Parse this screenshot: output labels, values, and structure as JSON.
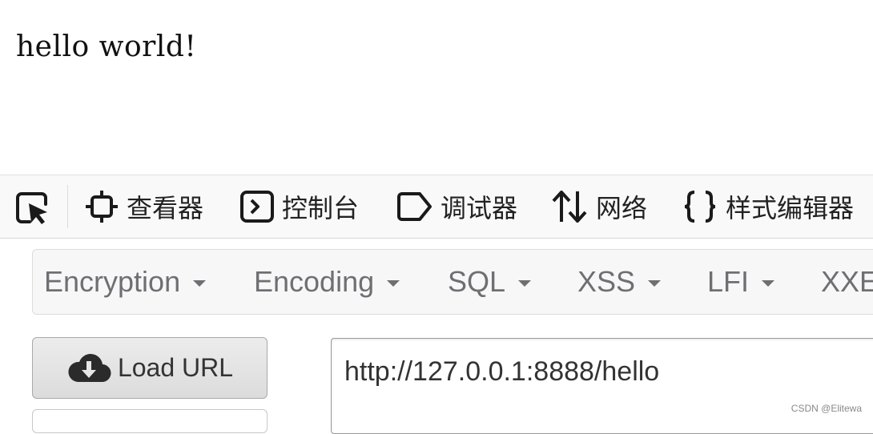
{
  "page": {
    "content_text": "hello world!"
  },
  "devtools": {
    "picker_icon": "element-picker-icon",
    "tabs": [
      {
        "label": "查看器",
        "icon": "inspector-icon"
      },
      {
        "label": "控制台",
        "icon": "console-icon"
      },
      {
        "label": "调试器",
        "icon": "debugger-icon"
      },
      {
        "label": "网络",
        "icon": "network-icon"
      },
      {
        "label": "样式编辑器",
        "icon": "braces-icon"
      }
    ]
  },
  "hackbar": {
    "menus": [
      {
        "label": "Encryption"
      },
      {
        "label": "Encoding"
      },
      {
        "label": "SQL"
      },
      {
        "label": "XSS"
      },
      {
        "label": "LFI"
      },
      {
        "label": "XXE"
      }
    ],
    "load_url_label": "Load URL",
    "load_url_icon": "cloud-download-icon",
    "url_value": "http://127.0.0.1:8888/hello"
  },
  "watermark": "CSDN @Elitewa",
  "colors": {
    "toolbar_bg": "#f9f9fa",
    "menu_text": "#6f6f73",
    "button_bg": "#dcdcdc"
  }
}
